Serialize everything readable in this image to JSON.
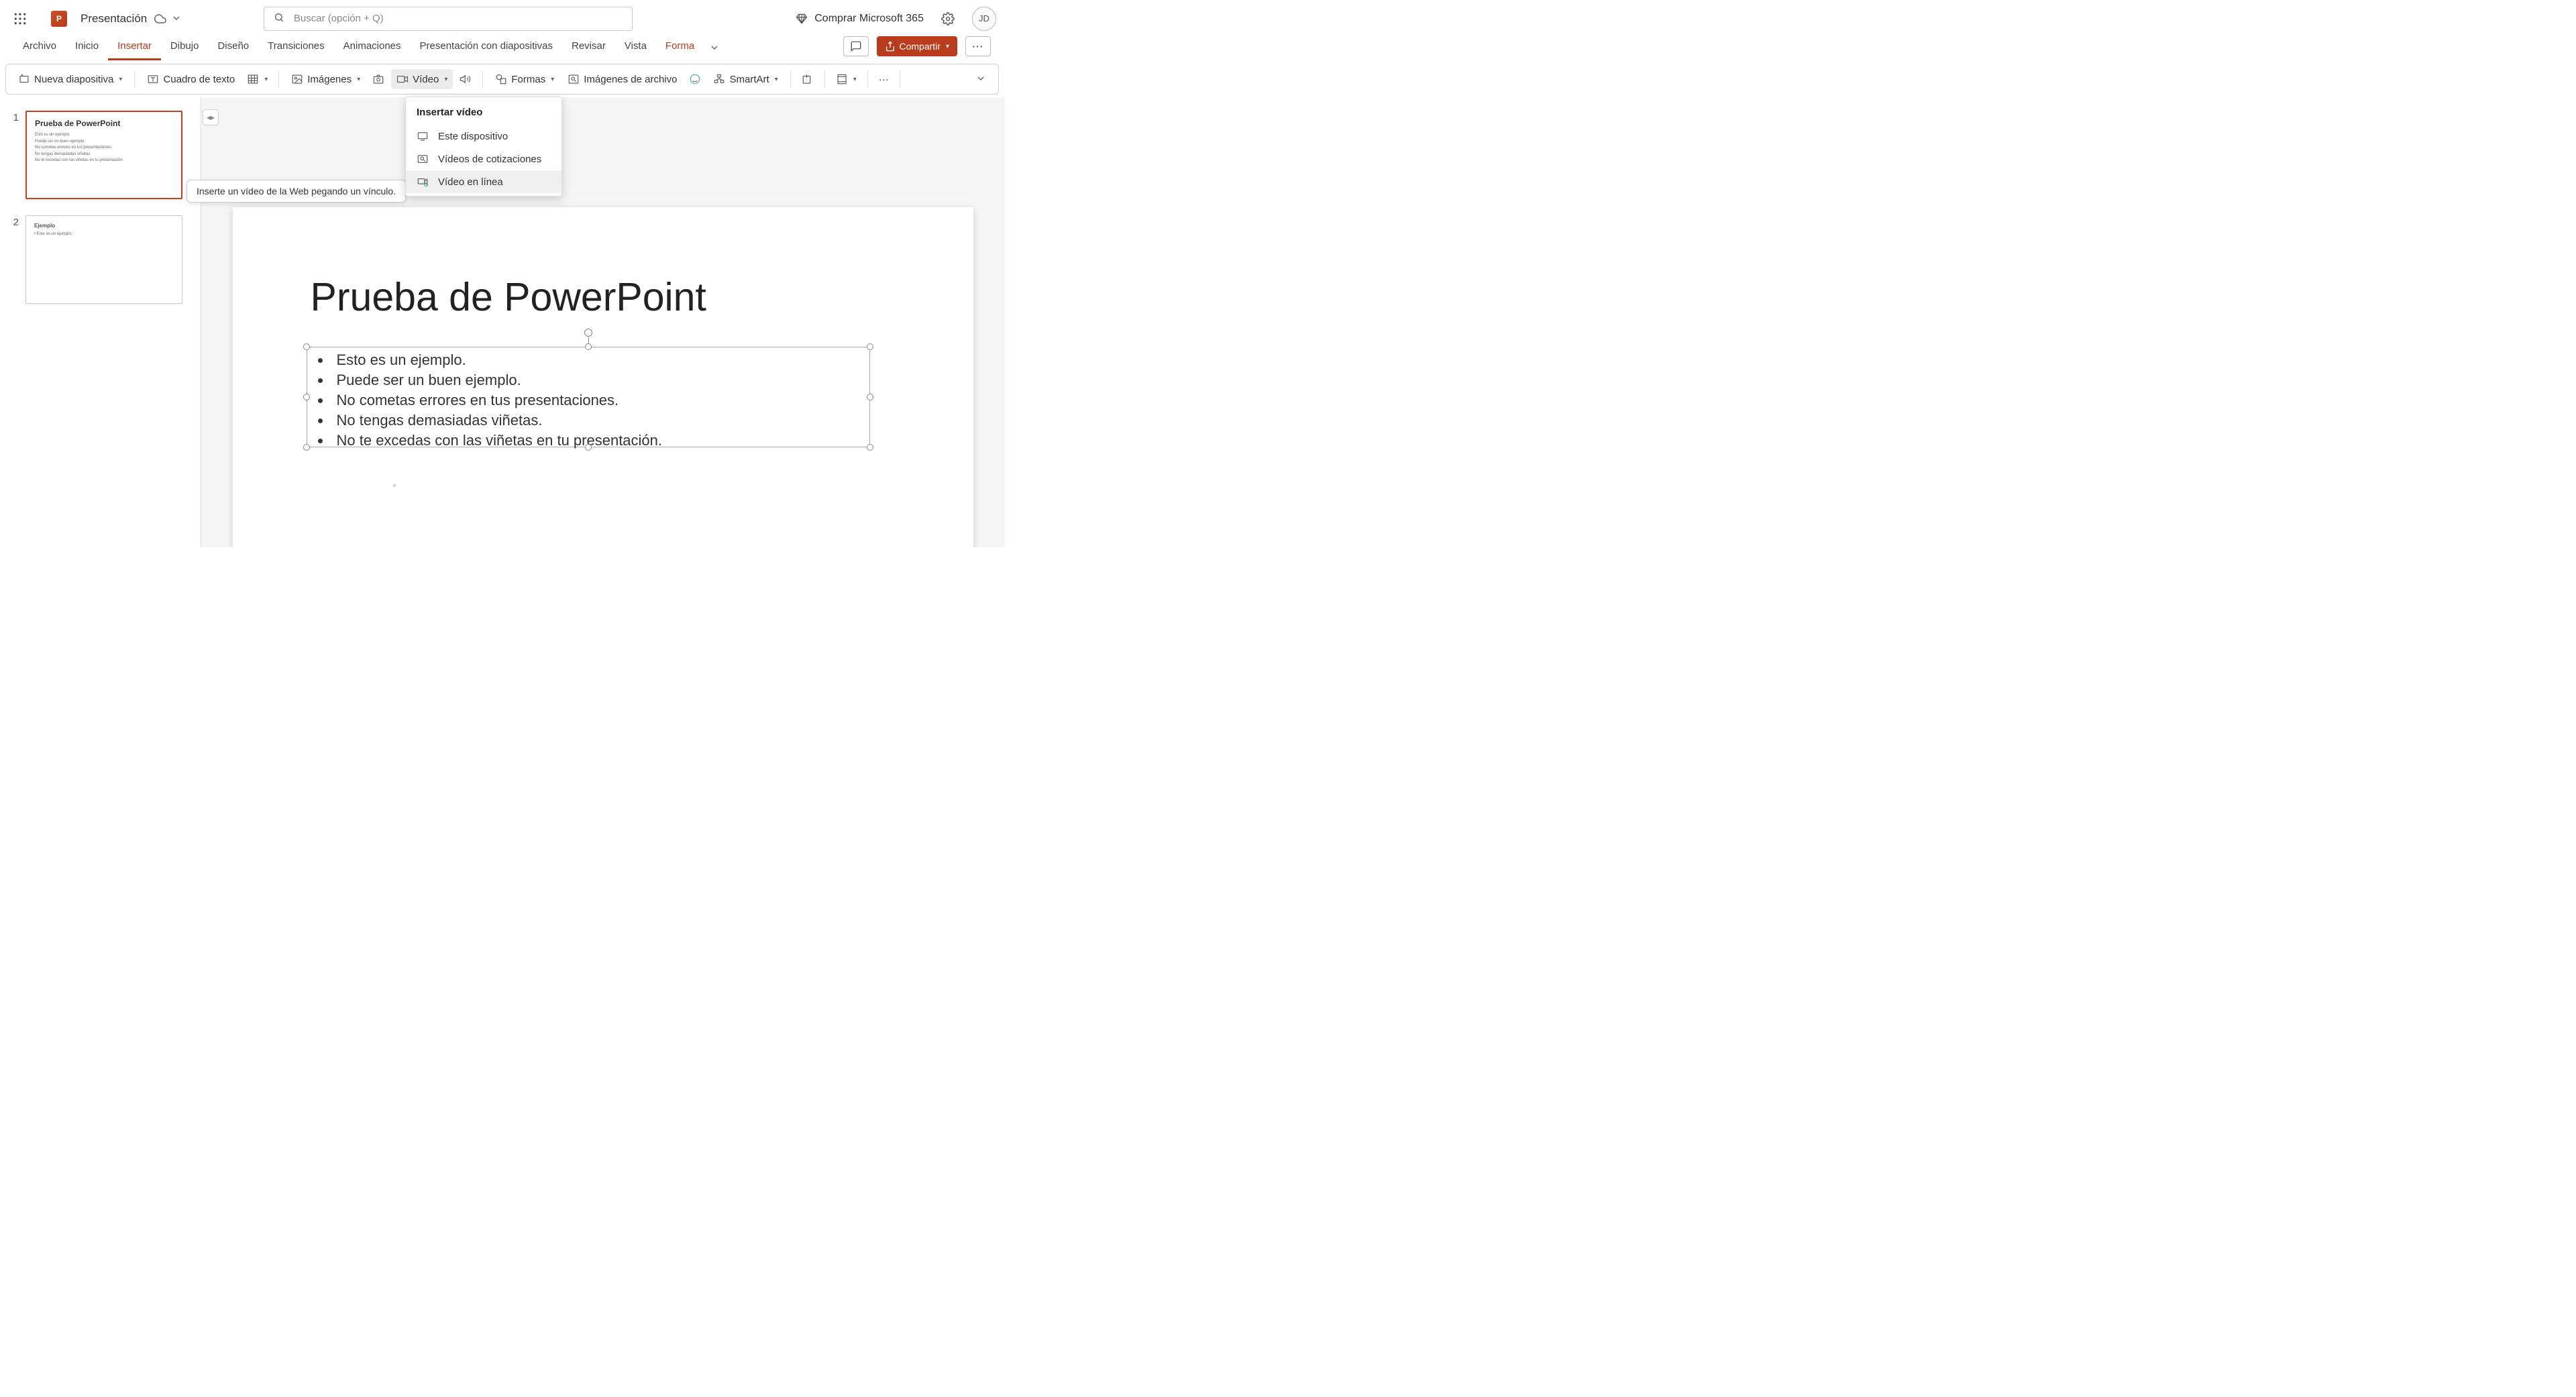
{
  "titlebar": {
    "file_name": "Presentación",
    "search_placeholder": "Buscar (opción + Q)",
    "buy_label": "Comprar Microsoft 365",
    "avatar_initials": "JD",
    "app_letter": "P"
  },
  "tabs": {
    "archivo": "Archivo",
    "inicio": "Inicio",
    "insertar": "Insertar",
    "dibujo": "Dibujo",
    "diseno": "Diseño",
    "transiciones": "Transiciones",
    "animaciones": "Animaciones",
    "presentacion": "Presentación con diapositivas",
    "revisar": "Revisar",
    "vista": "Vista",
    "forma": "Forma"
  },
  "ribbon_ctrls": {
    "compartir": "Compartir"
  },
  "toolbar": {
    "nueva": "Nueva diapositiva",
    "cuadro": "Cuadro de texto",
    "imagenes": "Imágenes",
    "video": "Vídeo",
    "formas": "Formas",
    "stock": "Imágenes de archivo",
    "smartart": "SmartArt"
  },
  "video_menu": {
    "header": "Insertar vídeo",
    "device": "Este dispositivo",
    "stock": "Vídeos de cotizaciones",
    "online": "Vídeo en línea"
  },
  "tooltip_text": "Inserte un vídeo de la Web pegando un vínculo.",
  "thumbs": {
    "n1": "1",
    "n2": "2",
    "t1_title": "Prueba de PowerPoint",
    "t1_b1": "Esto es un ejemplo.",
    "t1_b2": "Puede ser un buen ejemplo.",
    "t1_b3": "No cometas errores en tus presentaciones.",
    "t1_b4": "No tengas demasiadas viñetas.",
    "t1_b5": "No te excedas con las viñetas en tu presentación.",
    "t2_title": "Ejemplo",
    "t2_b1": "• Este es un ejemplo."
  },
  "slide": {
    "title": "Prueba de PowerPoint",
    "b1": "Esto es un ejemplo.",
    "b2": "Puede ser un buen ejemplo.",
    "b3": "No cometas errores en tus presentaciones.",
    "b4": "No tengas demasiadas viñetas.",
    "b5": "No te excedas con las viñetas en tu presentación."
  }
}
